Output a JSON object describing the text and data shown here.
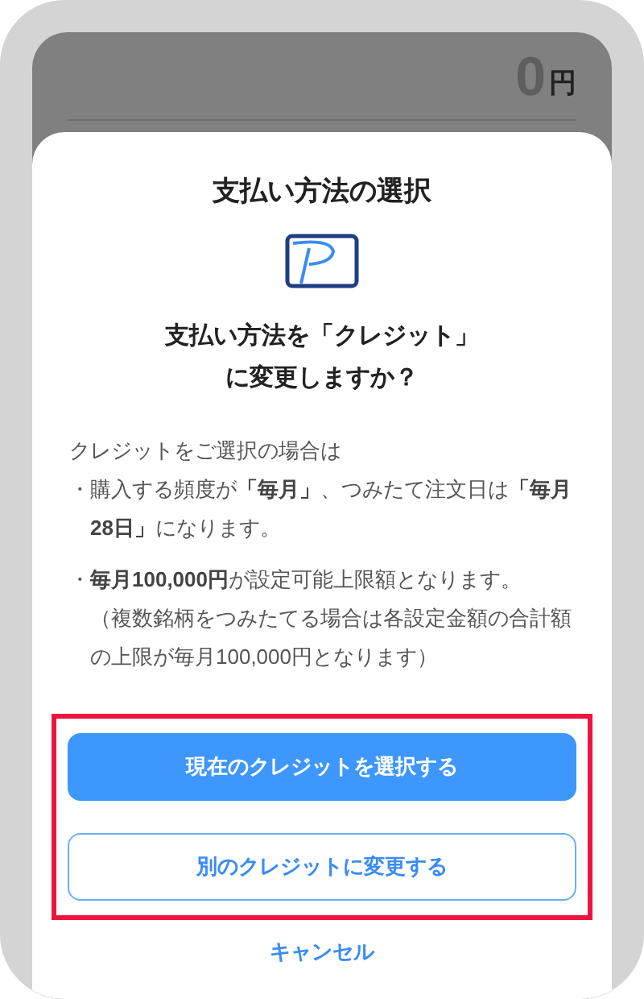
{
  "background": {
    "amount": "0",
    "currency": "円"
  },
  "dialog": {
    "title": "支払い方法の選択",
    "question": [
      "支払い方法を「クレジット」",
      "に変更しますか？"
    ],
    "intro": "クレジットをご選択の場合は",
    "bullets": [
      {
        "text": "・購入する頻度が**「毎月」**、つみたて注文日は**「毎月28日」**になります。"
      },
      {
        "text": "・**毎月100,000円**が設定可能上限額となります。",
        "note": "（複数銘柄をつみたてる場合は各設定金額の合計額の上限が毎月100,000円となります）"
      }
    ],
    "buttons": [
      {
        "label": "現在のクレジットを選択する",
        "kind": "primary"
      },
      {
        "label": "別のクレジットに変更する",
        "kind": "secondary"
      }
    ],
    "highlighted": true,
    "cancel": "キャンセル"
  }
}
